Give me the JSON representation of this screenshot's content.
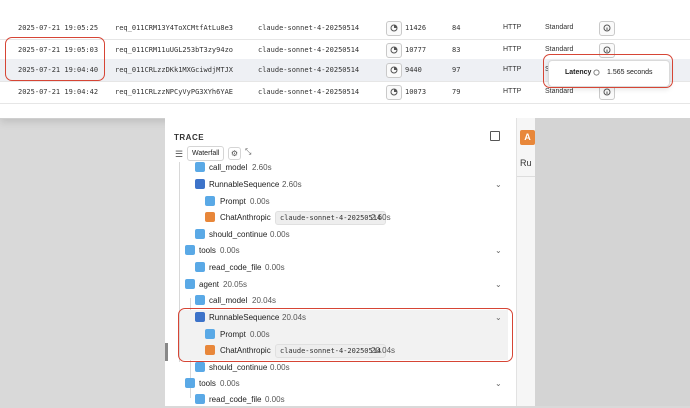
{
  "log_table": {
    "rows": [
      {
        "time": "2025-07-21 19:05:25",
        "request_id": "req_011CRM13Y4ToXCMtfAtLu8e3",
        "model": "claude-sonnet-4-20250514",
        "tokens": "11426",
        "score": "84",
        "protocol": "HTTP",
        "tier": "Standard"
      },
      {
        "time": "2025-07-21 19:05:03",
        "request_id": "req_011CRM11uUGL253bT3zy94zo",
        "model": "claude-sonnet-4-20250514",
        "tokens": "10777",
        "score": "83",
        "protocol": "HTTP",
        "tier": "Standard"
      },
      {
        "time": "2025-07-21 19:04:40",
        "request_id": "req_011CRLzzDKk1MXGciwdjMTJX",
        "model": "claude-sonnet-4-20250514",
        "tokens": "9440",
        "score": "97",
        "protocol": "HTTP",
        "tier": "S"
      },
      {
        "time": "2025-07-21 19:04:42",
        "request_id": "req_011CRLzzNPCyVyPG3XYh6YAE",
        "model": "claude-sonnet-4-20250514",
        "tokens": "10073",
        "score": "79",
        "protocol": "HTTP",
        "tier": "Standard"
      }
    ]
  },
  "latency_tooltip": {
    "label": "Latency",
    "value": "1.565 seconds"
  },
  "trace": {
    "title": "TRACE",
    "view_label": "Waterfall",
    "nodes": [
      {
        "name": "call_model",
        "duration": "2.60s"
      },
      {
        "name": "RunnableSequence",
        "duration": "2.60s"
      },
      {
        "name": "Prompt",
        "duration": "0.00s"
      },
      {
        "name": "ChatAnthropic",
        "model": "claude-sonnet-4-20250514",
        "duration": "2.60s"
      },
      {
        "name": "should_continue",
        "duration": "0.00s"
      },
      {
        "name": "tools",
        "duration": "0.00s"
      },
      {
        "name": "read_code_file",
        "duration": "0.00s"
      },
      {
        "name": "agent",
        "duration": "20.05s"
      },
      {
        "name": "call_model",
        "duration": "20.04s"
      },
      {
        "name": "RunnableSequence",
        "duration": "20.04s"
      },
      {
        "name": "Prompt",
        "duration": "0.00s"
      },
      {
        "name": "ChatAnthropic",
        "model": "claude-sonnet-4-20250514",
        "duration": "20.04s"
      },
      {
        "name": "should_continue",
        "duration": "0.00s"
      },
      {
        "name": "tools",
        "duration": "0.00s"
      },
      {
        "name": "read_code_file",
        "duration": "0.00s"
      }
    ]
  },
  "right_panel": {
    "badge": "A",
    "tab_fragment": "Ru"
  },
  "colors": {
    "annotation_red": "#d64535",
    "anthropic_orange": "#e8873a",
    "chain_blue": "#3d73c9",
    "node_blue": "#5aa9e6"
  }
}
